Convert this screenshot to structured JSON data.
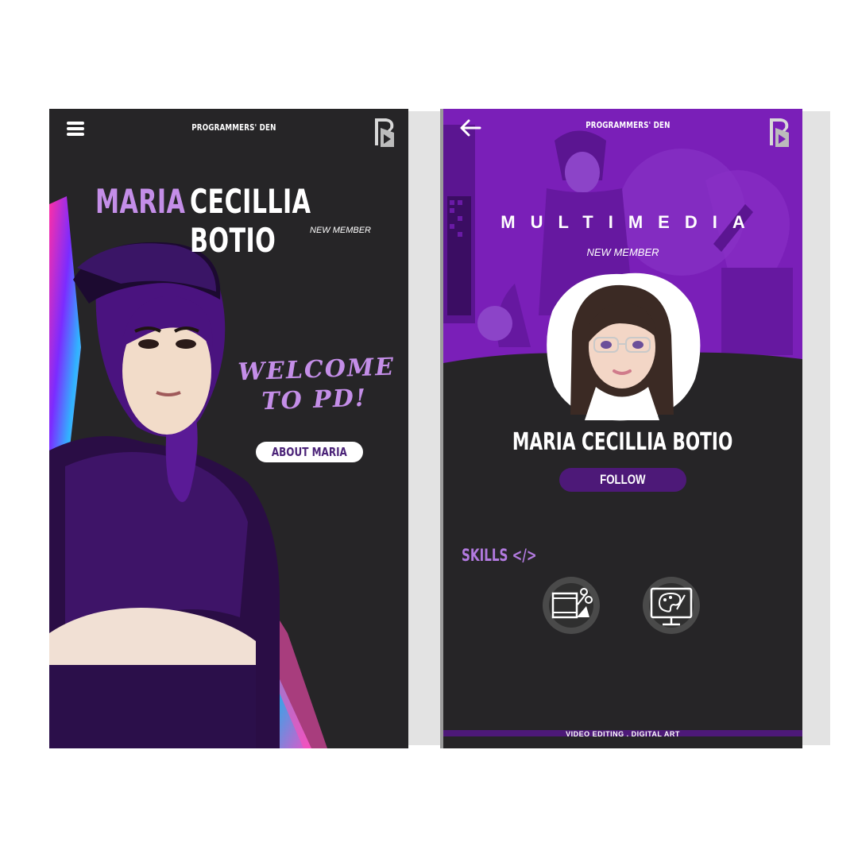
{
  "left_screen": {
    "app_title": "PROGRAMMERS' DEN",
    "first_name": "MARIA",
    "last_name": "CECILLIA BOTIO",
    "member_badge": "NEW MEMBER",
    "welcome_line1": "WELCOME",
    "welcome_line2": "TO PD!",
    "about_button": "ABOUT MARIA"
  },
  "right_screen": {
    "app_title": "PROGRAMMERS' DEN",
    "category": "MULTIMEDIA",
    "member_badge": "NEW MEMBER",
    "profile_name": "MARIA CECILLIA BOTIO",
    "follow_button": "FOLLOW",
    "skills_label": "SKILLS </>",
    "skills": [
      {
        "icon": "video-editing-icon"
      },
      {
        "icon": "digital-art-icon"
      }
    ],
    "footer_text": "VIDEO EDITING . DIGITAL ART"
  },
  "colors": {
    "background": "#262527",
    "accent_purple": "#c48ee8",
    "deep_purple": "#4d1978",
    "header_purple": "#7a1fb8"
  }
}
